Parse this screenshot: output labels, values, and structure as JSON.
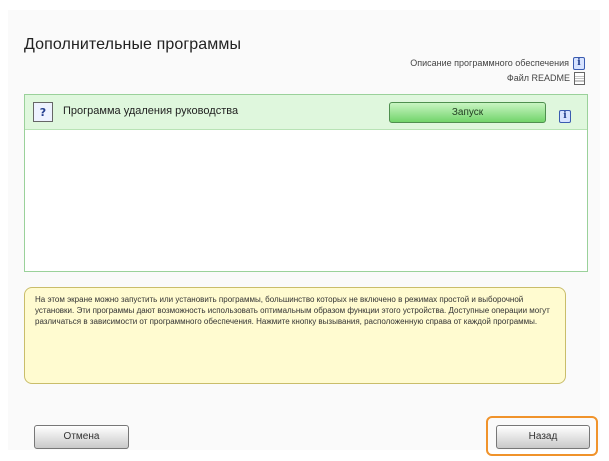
{
  "page": {
    "title": "Дополнительные программы"
  },
  "links": {
    "software_description": "Описание программного обеспечения",
    "readme": "Файл README"
  },
  "programs": [
    {
      "icon": "program-info-icon",
      "label": "Программа удаления руководства",
      "action_label": "Запуск"
    }
  ],
  "description": "На этом экране можно запустить или установить программы, большинство которых не включено в режимах простой и выборочной установки. Эти программы дают возможность использовать оптимальным образом функции этого устройства. Доступные операции могут различаться в зависимости от программного обеспечения. Нажмите кнопку вызывания, расположенную справа от каждой программы.",
  "footer": {
    "cancel_label": "Отмена",
    "back_label": "Назад"
  },
  "colors": {
    "row_highlight": "#dff7dd",
    "launch_button": "#72d46b",
    "description_bg": "#fffbd0",
    "focus_outline": "#f0932b"
  }
}
